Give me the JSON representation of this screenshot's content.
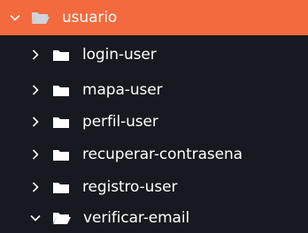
{
  "colors": {
    "root_row_background": "#f26a3d",
    "list_background": "#16191f",
    "text": "#ffffff",
    "root_folder_icon": "#cfd3dc",
    "folder_icon": "#ffffff",
    "chevron": "#ffffff"
  },
  "explorer": {
    "root": {
      "label": "usuario",
      "state": "expanded",
      "chevron_icon": "chevron-down-icon",
      "folder_icon": "folder-open-icon"
    },
    "children": [
      {
        "label": "login-user",
        "state": "collapsed",
        "chevron_icon": "chevron-right-icon",
        "folder_icon": "folder-icon"
      },
      {
        "label": "mapa-user",
        "state": "collapsed",
        "chevron_icon": "chevron-right-icon",
        "folder_icon": "folder-icon"
      },
      {
        "label": "perfil-user",
        "state": "collapsed",
        "chevron_icon": "chevron-right-icon",
        "folder_icon": "folder-icon"
      },
      {
        "label": "recuperar-contrasena",
        "state": "collapsed",
        "chevron_icon": "chevron-right-icon",
        "folder_icon": "folder-icon"
      },
      {
        "label": "registro-user",
        "state": "collapsed",
        "chevron_icon": "chevron-right-icon",
        "folder_icon": "folder-icon"
      },
      {
        "label": "verificar-email",
        "state": "expanded",
        "chevron_icon": "chevron-down-icon",
        "folder_icon": "folder-open-icon"
      }
    ]
  }
}
